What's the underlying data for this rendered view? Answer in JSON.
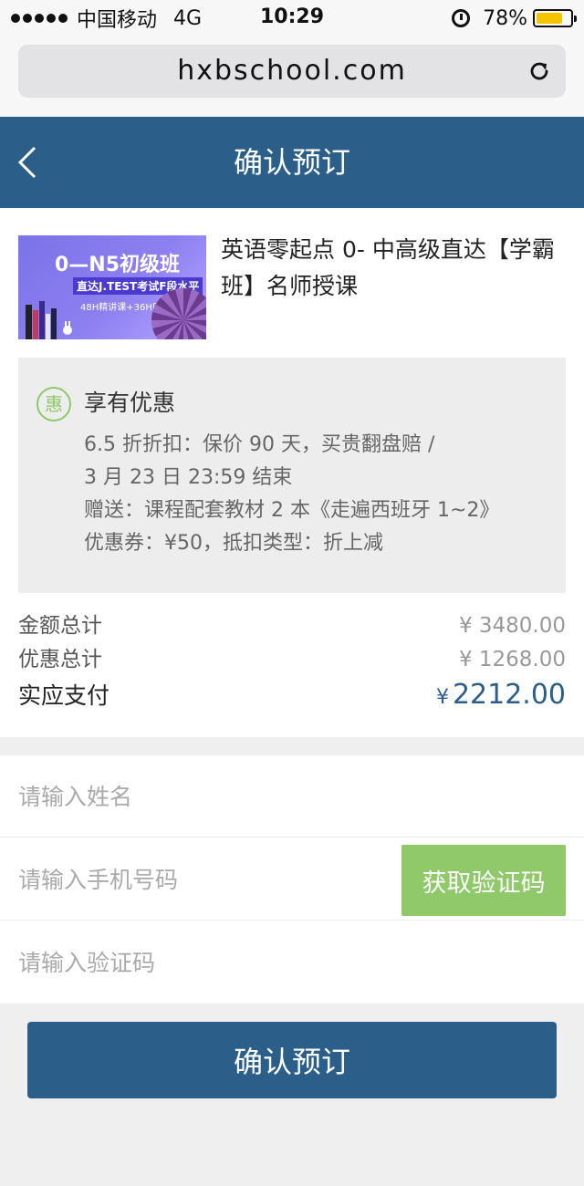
{
  "status_bar": {
    "carrier": "中国移动",
    "network": "4G",
    "time": "10:29",
    "battery_percent": "78%",
    "battery_level": 0.78,
    "battery_color": "#f5c400"
  },
  "browser": {
    "url": "hxbschool.com",
    "reload_icon": "reload-icon"
  },
  "header": {
    "title": "确认预订",
    "back_icon": "chevron-left-icon",
    "color": "#2b5f89"
  },
  "course": {
    "thumb_title": "0—N5初级班",
    "thumb_subtitle": "直达J.TEST考试F段水平",
    "thumb_caption": "48H精讲课+36H口语课",
    "name": "英语零起点 0- 中高级直达【学霸班】名师授课"
  },
  "promo": {
    "badge": "惠",
    "heading": "享有优惠",
    "lines": [
      "6.5 折折扣：保价 90 天，买贵翻盘赔 /",
      "3 月 23 日 23:59 结束",
      "赠送：课程配套教材 2 本《走遍西班牙 1~2》",
      "优惠券：¥50，抵扣类型：折上减"
    ]
  },
  "summary": {
    "total_label": "金额总计",
    "total_value": "¥ 3480.00",
    "discount_label": "优惠总计",
    "discount_value": "¥ 1268.00",
    "pay_label": "实应支付",
    "pay_currency": "¥",
    "pay_value": "2212.00"
  },
  "form": {
    "name_placeholder": "请输入姓名",
    "phone_placeholder": "请输入手机号码",
    "code_placeholder": "请输入验证码",
    "get_code_label": "获取验证码",
    "accent_green": "#8fc96a"
  },
  "submit_label": "确认预订"
}
